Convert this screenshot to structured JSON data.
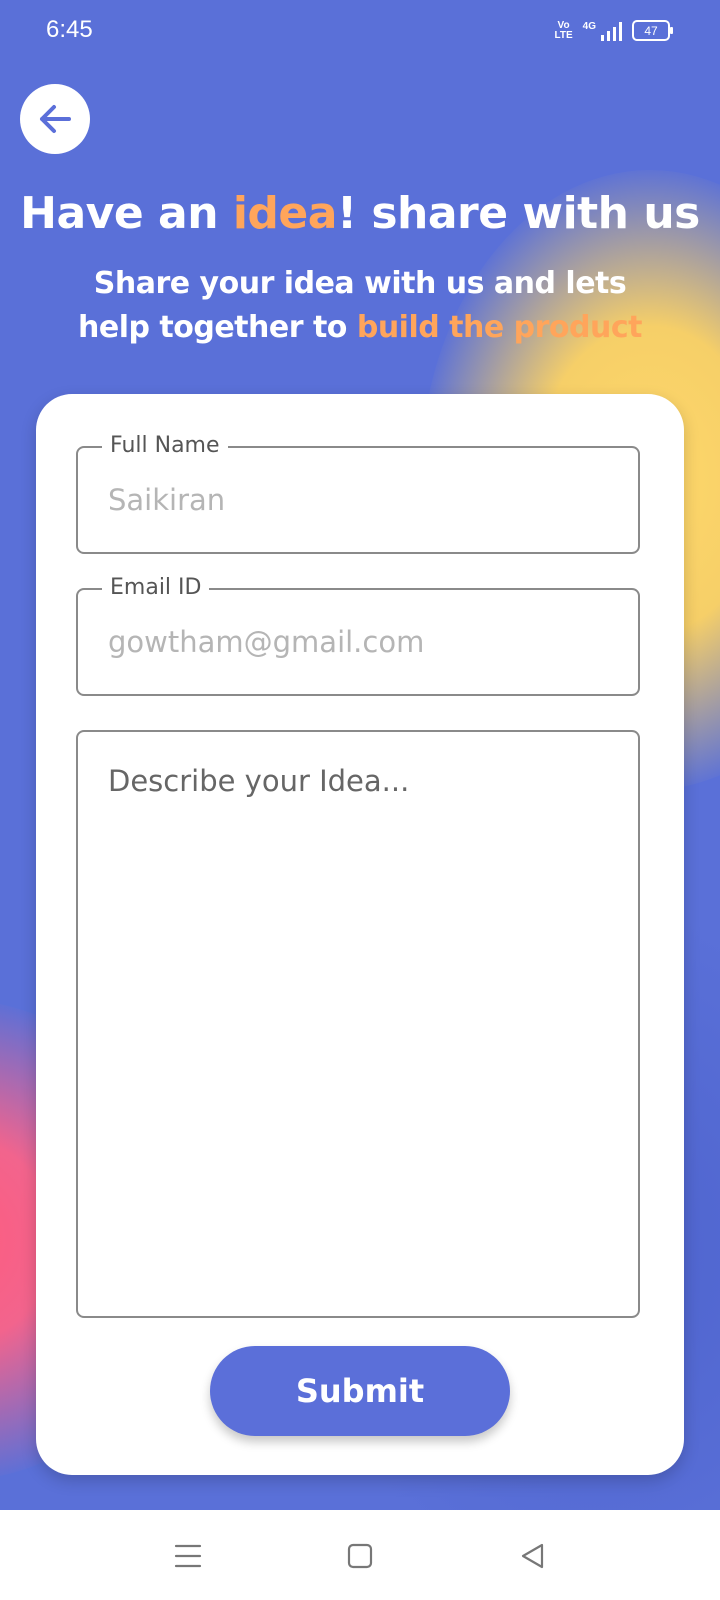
{
  "status_bar": {
    "time": "6:45",
    "volte_top": "Vo",
    "volte_bottom": "LTE",
    "network": "4G",
    "battery": "47"
  },
  "header": {
    "title_part1": "Have an ",
    "title_accent": "idea",
    "title_part2": "! share with us",
    "subtitle_part1": "Share your idea with us and lets help together to ",
    "subtitle_accent": "build the product"
  },
  "form": {
    "full_name_label": "Full Name",
    "full_name_placeholder": "Saikiran",
    "email_label": "Email ID",
    "email_placeholder": "gowtham@gmail.com",
    "idea_placeholder": "Describe your Idea...",
    "submit_label": "Submit"
  },
  "colors": {
    "background": "#5a70d8",
    "accent": "#ffa55b",
    "button": "#5b6fd9"
  },
  "icons": {
    "back": "arrow-left-icon",
    "nav_menu": "menu-icon",
    "nav_home": "square-home-icon",
    "nav_back": "triangle-back-icon"
  }
}
